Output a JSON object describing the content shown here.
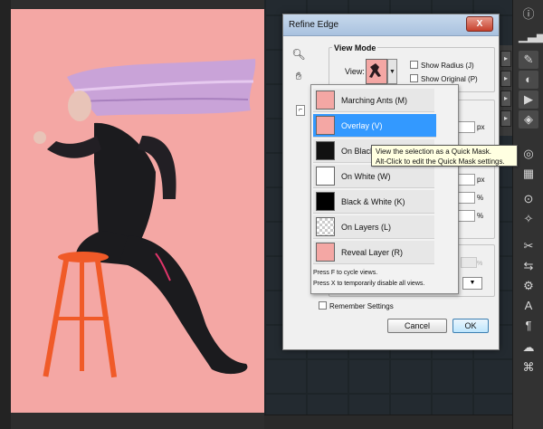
{
  "dialog": {
    "title": "Refine Edge",
    "close_label": "X",
    "view_mode_label": "View Mode",
    "view_label": "View:",
    "show_radius": "Show Radius (J)",
    "show_original": "Show Original (P)",
    "remember_settings": "Remember Settings",
    "cancel_label": "Cancel",
    "ok_label": "OK",
    "units": {
      "px1": "px",
      "px2": "px",
      "pct1": "%",
      "pct2": "%",
      "pct_disabled": "%"
    }
  },
  "view_menu": {
    "items": [
      {
        "label": "Marching Ants (M)",
        "icon": "marching-ants-thumb"
      },
      {
        "label": "Overlay (V)",
        "icon": "overlay-thumb",
        "selected": true
      },
      {
        "label": "On Black (B)",
        "icon": "on-black-thumb"
      },
      {
        "label": "On White (W)",
        "icon": "on-white-thumb"
      },
      {
        "label": "Black & White (K)",
        "icon": "black-white-thumb"
      },
      {
        "label": "On Layers (L)",
        "icon": "on-layers-thumb"
      },
      {
        "label": "Reveal Layer (R)",
        "icon": "reveal-layer-thumb"
      }
    ],
    "hint_cycle": "Press F to cycle views.",
    "hint_disable": "Press X to temporarily disable all views."
  },
  "tooltip": {
    "line1": "View the selection as a Quick Mask.",
    "line2": "Alt-Click to edit the Quick Mask settings."
  },
  "colors": {
    "canvas_bg": "#f4a7a4",
    "selected_item": "#3399ff",
    "tooltip_bg": "#ffffe1",
    "stool": "#f05a28",
    "hair": "#c9a3d8"
  },
  "toolbar_icons": [
    "info-icon",
    "histogram-icon",
    "brush-icon",
    "adjust-icon",
    "play-icon",
    "layers-icon",
    "channels-icon",
    "paths-icon",
    "swatches-icon",
    "styles-icon",
    "character-icon",
    "paragraph-icon",
    "tool-presets-icon",
    "clone-icon",
    "3d-icon"
  ]
}
